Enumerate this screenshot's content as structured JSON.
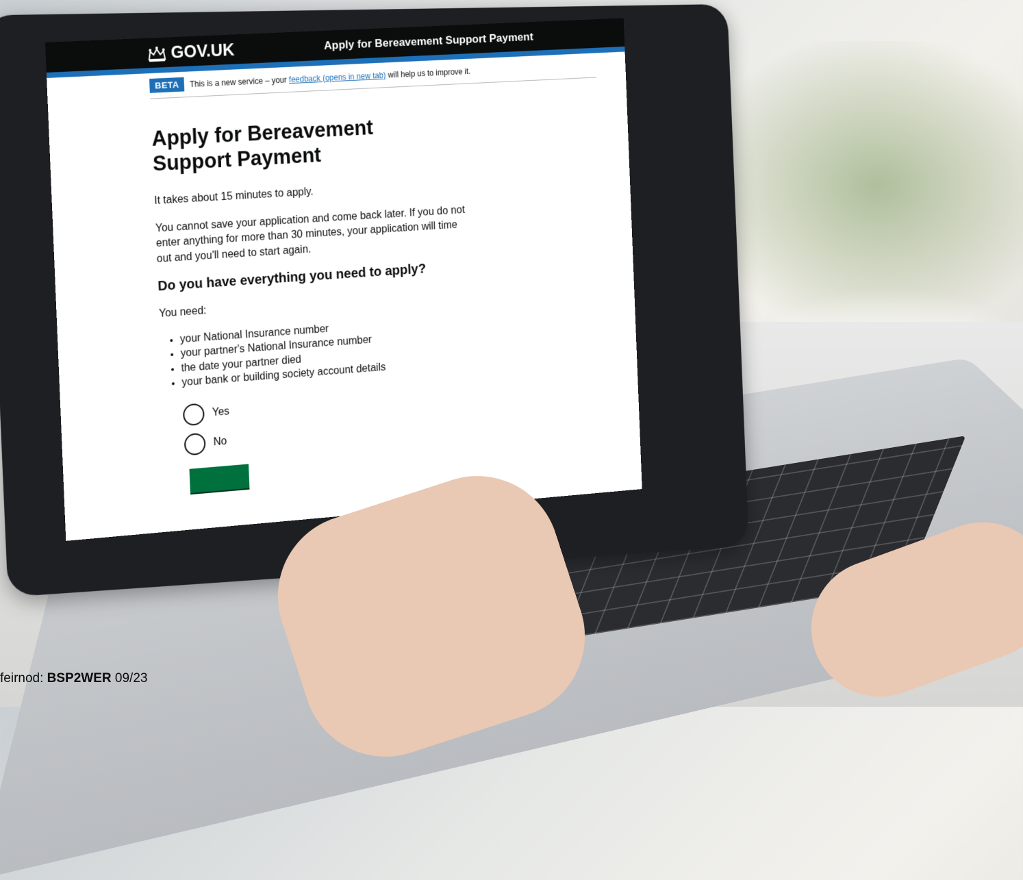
{
  "header": {
    "logo_text": "GOV.UK",
    "service_name": "Apply for Bereavement Support Payment"
  },
  "phase_banner": {
    "tag": "BETA",
    "text_before": "This is a new service – your",
    "link_text": "feedback (opens in new tab)",
    "text_after": "will help us to improve it."
  },
  "main": {
    "title": "Apply for Bereavement Support Payment",
    "intro": "It takes about 15 minutes to apply.",
    "timeout_notice": "You cannot save your application and come back later. If you do not enter anything for more than 30 minutes, your application will time out and you'll need to start again.",
    "question": "Do you have everything you need to apply?",
    "list_intro": "You need:",
    "requirements": [
      "your National Insurance number",
      "your partner's National Insurance number",
      "the date your partner died",
      "your bank or building society account details"
    ],
    "options": [
      "Yes",
      "No"
    ],
    "colors": {
      "header": "#0b0c0c",
      "brand_blue": "#1d70b8",
      "button_green": "#00703c"
    }
  },
  "footer_code": {
    "label": "feirnod:",
    "code": "BSP2WER",
    "date": "09/23"
  }
}
